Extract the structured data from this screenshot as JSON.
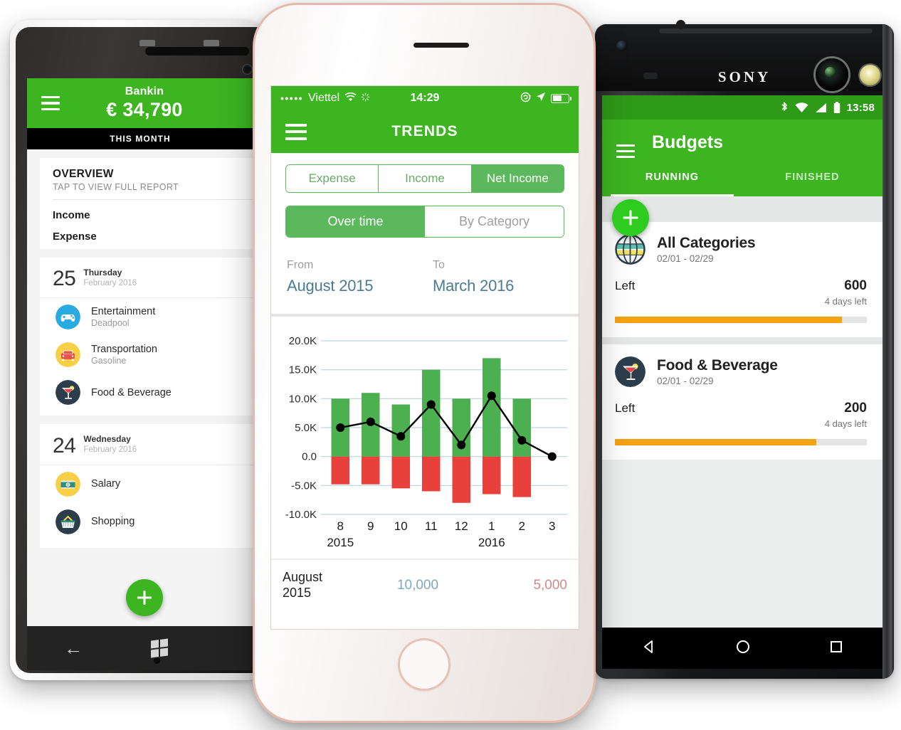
{
  "colors": {
    "brand_green": "#3cb521",
    "segment_green": "#5cb85c",
    "bar_income": "#4caf50",
    "bar_expense": "#e8403a",
    "progress_orange": "#f6a211",
    "link_blue": "#4a7b93",
    "expense_red": "#cf8a8a"
  },
  "windows_phone": {
    "device_name": "windows-phone",
    "appbar": {
      "menu_icon": "hamburger-icon",
      "app_name": "Bankin",
      "balance": "€ 34,790"
    },
    "period_bar": "THIS MONTH",
    "overview": {
      "title": "OVERVIEW",
      "subtitle": "TAP TO VIEW FULL REPORT",
      "rows": [
        "Income",
        "Expense"
      ]
    },
    "day_groups": [
      {
        "day": "25",
        "weekday": "Thursday",
        "date": "February 2016",
        "transactions": [
          {
            "icon": "game-controller-icon",
            "title": "Entertainment",
            "subtitle": "Deadpool"
          },
          {
            "icon": "car-icon",
            "title": "Transportation",
            "subtitle": "Gasoline"
          },
          {
            "icon": "cocktail-icon",
            "title": "Food & Beverage",
            "subtitle": ""
          }
        ]
      },
      {
        "day": "24",
        "weekday": "Wednesday",
        "date": "February 2016",
        "transactions": [
          {
            "icon": "banknote-icon",
            "title": "Salary",
            "subtitle": ""
          },
          {
            "icon": "shopping-basket-icon",
            "title": "Shopping",
            "subtitle": ""
          }
        ]
      }
    ],
    "fab": "add-transaction-fab",
    "navbar": {
      "back": "back-arrow-icon",
      "home": "windows-logo-icon"
    }
  },
  "iphone": {
    "device_name": "iphone",
    "status_bar": {
      "signal_dots": "•••••",
      "carrier": "Viettel",
      "wifi_icon": "wifi-icon",
      "sync_icon": "sync-spinner-icon",
      "time": "14:29",
      "rotation_lock_icon": "rotation-lock-icon",
      "location_icon": "location-arrow-icon",
      "battery_icon": "battery-icon"
    },
    "navbar": {
      "menu_icon": "hamburger-icon",
      "title": "TRENDS"
    },
    "segment_type": {
      "options": [
        "Expense",
        "Income",
        "Net Income"
      ],
      "selected": "Net Income"
    },
    "segment_view": {
      "options": [
        "Over time",
        "By Category"
      ],
      "selected": "Over time"
    },
    "date_range": {
      "from_label": "From",
      "from_value": "August 2015",
      "to_label": "To",
      "to_value": "March 2016"
    },
    "summary": {
      "period_line1": "August",
      "period_line2": "2015",
      "income": "10,000",
      "expense": "5,000"
    }
  },
  "chart_data": {
    "type": "bar",
    "title": "",
    "xlabel": "",
    "ylabel": "",
    "ylim": [
      -10000,
      20000
    ],
    "grid": true,
    "ytick_labels": [
      "20.0K",
      "15.0K",
      "10.0K",
      "5.0K",
      "0.0",
      "-5.0K",
      "-10.0K"
    ],
    "ytick_values": [
      20000,
      15000,
      10000,
      5000,
      0,
      -5000,
      -10000
    ],
    "categories": [
      "8",
      "9",
      "10",
      "11",
      "12",
      "1",
      "2",
      "3"
    ],
    "group_labels": [
      {
        "label": "2015",
        "index": 0
      },
      {
        "label": "2016",
        "index": 5
      }
    ],
    "series": [
      {
        "name": "Income",
        "type": "bar",
        "color": "#4caf50",
        "values": [
          10000,
          11000,
          9000,
          15000,
          10000,
          17000,
          10000,
          0
        ]
      },
      {
        "name": "Expense",
        "type": "bar",
        "color": "#e8403a",
        "values": [
          -4800,
          -4800,
          -5500,
          -6000,
          -8000,
          -6500,
          -7000,
          0
        ]
      },
      {
        "name": "Net Income",
        "type": "line",
        "color": "#000000",
        "values": [
          5000,
          6000,
          3500,
          9000,
          2000,
          10500,
          2800,
          0
        ]
      }
    ]
  },
  "sony_android": {
    "device_name": "sony-android",
    "brand": "SONY",
    "status_bar": {
      "bluetooth_icon": "bluetooth-icon",
      "wifi_icon": "wifi-icon",
      "signal_icon": "cell-signal-icon",
      "battery_icon": "battery-icon",
      "time": "13:58"
    },
    "appbar": {
      "menu_icon": "hamburger-icon",
      "title": "Budgets"
    },
    "tabs": [
      {
        "label": "RUNNING",
        "active": true
      },
      {
        "label": "FINISHED",
        "active": false
      }
    ],
    "fab": "add-budget-fab",
    "budgets": [
      {
        "icon": "globe-icon",
        "name": "All Categories",
        "dates": "02/01 - 02/29",
        "left_label": "Left",
        "amount": "600",
        "days_left": "4 days left",
        "progress_percent": 90
      },
      {
        "icon": "cocktail-icon",
        "name": "Food & Beverage",
        "dates": "02/01 - 02/29",
        "left_label": "Left",
        "amount": "200",
        "days_left": "4 days left",
        "progress_percent": 80
      }
    ],
    "navbar": {
      "back": "back-triangle-icon",
      "home": "home-circle-icon",
      "recents": "recents-square-icon"
    }
  }
}
